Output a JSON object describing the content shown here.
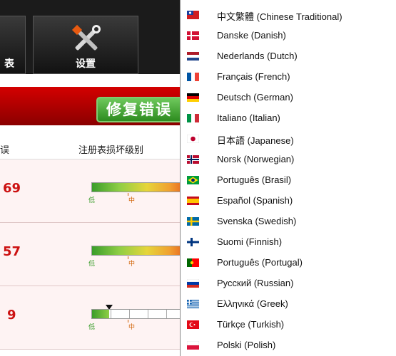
{
  "toolbar": {
    "left_label": "表",
    "settings_label": "设置"
  },
  "fix_button_label": "修复错误",
  "table": {
    "col_errors": "误",
    "col_level": "注册表损坏级别"
  },
  "rows": [
    {
      "count": "69",
      "low": "低",
      "mid": "中"
    },
    {
      "count": "57",
      "low": "低",
      "mid": "中"
    },
    {
      "count": "9",
      "low": "低",
      "mid": "中"
    }
  ],
  "languages": [
    {
      "label": "中文繁體 (Chinese Traditional)",
      "flag": "taiwan-flag"
    },
    {
      "label": "Danske (Danish)",
      "flag": "denmark-flag"
    },
    {
      "label": "Nederlands (Dutch)",
      "flag": "netherlands-flag"
    },
    {
      "label": "Français (French)",
      "flag": "france-flag"
    },
    {
      "label": "Deutsch (German)",
      "flag": "germany-flag"
    },
    {
      "label": "Italiano (Italian)",
      "flag": "italy-flag"
    },
    {
      "label": "日本語 (Japanese)",
      "flag": "japan-flag"
    },
    {
      "label": "Norsk (Norwegian)",
      "flag": "norway-flag"
    },
    {
      "label": "Português (Brasil)",
      "flag": "brazil-flag"
    },
    {
      "label": "Español (Spanish)",
      "flag": "spain-flag"
    },
    {
      "label": "Svenska (Swedish)",
      "flag": "sweden-flag"
    },
    {
      "label": "Suomi (Finnish)",
      "flag": "finland-flag"
    },
    {
      "label": "Português (Portugal)",
      "flag": "portugal-flag"
    },
    {
      "label": "Русский (Russian)",
      "flag": "russia-flag"
    },
    {
      "label": "Ελληνικά (Greek)",
      "flag": "greece-flag"
    },
    {
      "label": "Türkçe (Turkish)",
      "flag": "turkey-flag"
    },
    {
      "label": "Polski (Polish)",
      "flag": "poland-flag"
    }
  ]
}
